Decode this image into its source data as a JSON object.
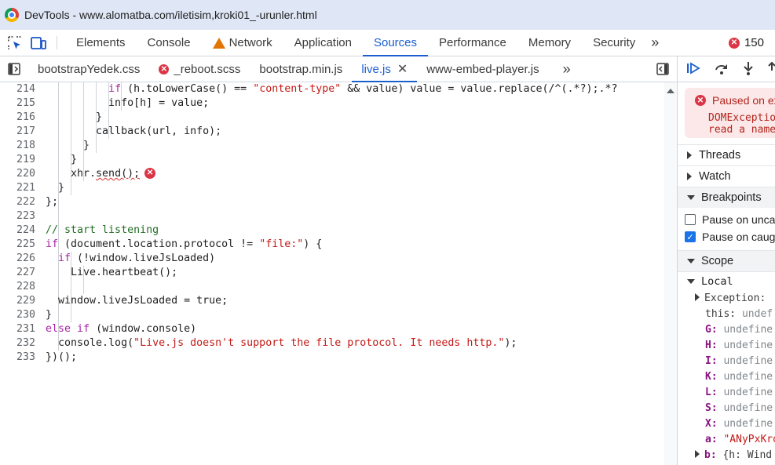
{
  "window": {
    "title": "DevTools - www.alomatba.com/iletisim,kroki01_-urunler.html"
  },
  "main_tabs": [
    {
      "label": "Elements"
    },
    {
      "label": "Console"
    },
    {
      "label": "Network"
    },
    {
      "label": "Application"
    },
    {
      "label": "Sources"
    },
    {
      "label": "Performance"
    },
    {
      "label": "Memory"
    },
    {
      "label": "Security"
    }
  ],
  "more_tabs": "»",
  "error_count": "150",
  "file_tabs": [
    {
      "label": "bootstrapYedek.css"
    },
    {
      "label": "_reboot.scss"
    },
    {
      "label": "bootstrap.min.js"
    },
    {
      "label": "live.js"
    },
    {
      "label": "www-embed-player.js"
    }
  ],
  "code_lines": [
    {
      "n": "214",
      "code": "          if (h.toLowerCase() == \"content-type\" && value) value = value.replace(/^(.*?);.*?"
    },
    {
      "n": "215",
      "code": "          info[h] = value;"
    },
    {
      "n": "216",
      "code": "        }"
    },
    {
      "n": "217",
      "code": "        callback(url, info);"
    },
    {
      "n": "218",
      "code": "      }"
    },
    {
      "n": "219",
      "code": "    }"
    },
    {
      "n": "220",
      "code": "    xhr.send();"
    },
    {
      "n": "221",
      "code": "  }"
    },
    {
      "n": "222",
      "code": "};"
    },
    {
      "n": "223",
      "code": ""
    },
    {
      "n": "224",
      "code": "// start listening"
    },
    {
      "n": "225",
      "code": "if (document.location.protocol != \"file:\") {"
    },
    {
      "n": "226",
      "code": "  if (!window.liveJsLoaded)"
    },
    {
      "n": "227",
      "code": "    Live.heartbeat();"
    },
    {
      "n": "228",
      "code": ""
    },
    {
      "n": "229",
      "code": "  window.liveJsLoaded = true;"
    },
    {
      "n": "230",
      "code": "}"
    },
    {
      "n": "231",
      "code": "else if (window.console)"
    },
    {
      "n": "232",
      "code": "  console.log(\"Live.js doesn't support the file protocol. It needs http.\");"
    },
    {
      "n": "233",
      "code": "})();"
    }
  ],
  "sidebar": {
    "paused_title": "Paused on ex",
    "paused_message_1": "DOMExceptio",
    "paused_message_2": "read a name",
    "threads": "Threads",
    "watch": "Watch",
    "breakpoints": "Breakpoints",
    "pause_uncaught": "Pause on unca",
    "pause_caught": "Pause on caug",
    "scope": "Scope",
    "local": "Local",
    "scope_vars": [
      {
        "key": "Exception:",
        "value": "",
        "kind": "plain",
        "expandable": true
      },
      {
        "key": "this:",
        "value": "undef",
        "kind": "plain",
        "expandable": false
      },
      {
        "key": "G:",
        "value": "undefine",
        "kind": "undef",
        "expandable": false
      },
      {
        "key": "H:",
        "value": "undefine",
        "kind": "undef",
        "expandable": false
      },
      {
        "key": "I:",
        "value": "undefine",
        "kind": "undef",
        "expandable": false
      },
      {
        "key": "K:",
        "value": "undefine",
        "kind": "undef",
        "expandable": false
      },
      {
        "key": "L:",
        "value": "undefine",
        "kind": "undef",
        "expandable": false
      },
      {
        "key": "S:",
        "value": "undefine",
        "kind": "undef",
        "expandable": false
      },
      {
        "key": "X:",
        "value": "undefine",
        "kind": "undef",
        "expandable": false
      },
      {
        "key": "a:",
        "value": "\"ANyPxKro",
        "kind": "str",
        "expandable": false
      },
      {
        "key": "b:",
        "value": "{h: Wind",
        "kind": "obj",
        "expandable": true
      }
    ]
  },
  "colors": {
    "accent": "#1a5fd0",
    "error": "#dc3545",
    "warning": "#e37400",
    "titlebar_bg": "#dfe6f6"
  }
}
